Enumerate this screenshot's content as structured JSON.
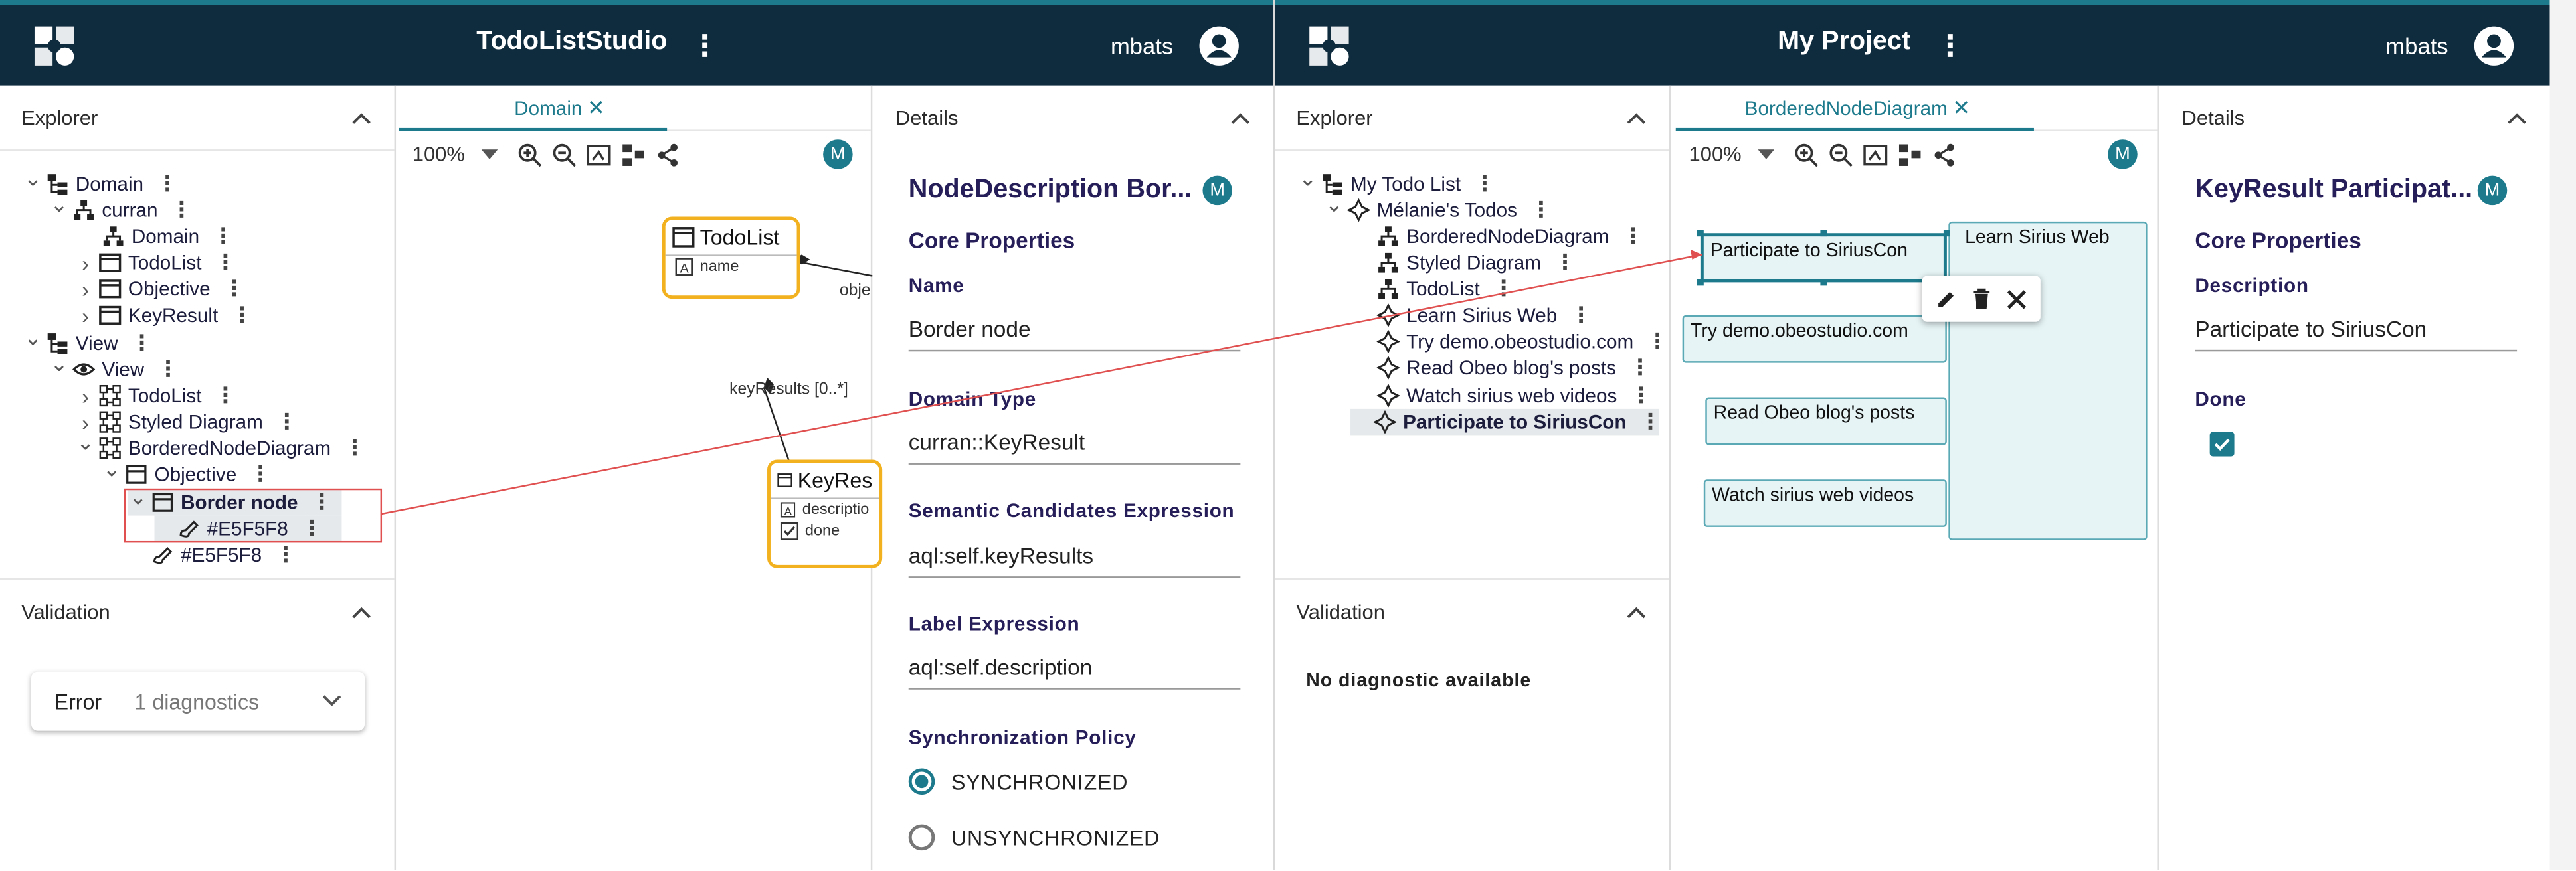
{
  "left_app": {
    "title": "TodoListStudio",
    "user": "mbats",
    "explorer": {
      "header": "Explorer",
      "items": [
        {
          "label": "Domain",
          "icon": "domain-tree-icon",
          "toggle": "v"
        },
        {
          "label": "curran",
          "icon": "hierarchy-icon",
          "toggle": "v"
        },
        {
          "label": "Domain",
          "icon": "hierarchy-icon",
          "toggle": ""
        },
        {
          "label": "TodoList",
          "icon": "entity-icon",
          "toggle": ">"
        },
        {
          "label": "Objective",
          "icon": "entity-icon",
          "toggle": ">"
        },
        {
          "label": "KeyResult",
          "icon": "entity-icon",
          "toggle": ">"
        },
        {
          "label": "View",
          "icon": "domain-tree-icon",
          "toggle": "v"
        },
        {
          "label": "View",
          "icon": "eye-icon",
          "toggle": "v"
        },
        {
          "label": "TodoList",
          "icon": "diagram-icon",
          "toggle": ">"
        },
        {
          "label": "Styled Diagram",
          "icon": "diagram-icon",
          "toggle": ">"
        },
        {
          "label": "BorderedNodeDiagram",
          "icon": "diagram-icon",
          "toggle": "v"
        },
        {
          "label": "Objective",
          "icon": "node-icon",
          "toggle": "v"
        },
        {
          "label": "Border node",
          "icon": "node-icon",
          "toggle": "v"
        },
        {
          "label": "#E5F5F8",
          "icon": "style-icon",
          "toggle": ""
        },
        {
          "label": "#E5F5F8",
          "icon": "style-icon",
          "toggle": ""
        }
      ]
    },
    "validation": {
      "header": "Validation",
      "severity": "Error",
      "count": "1 diagnostics"
    },
    "canvas": {
      "tab": "Domain",
      "zoom": "100%",
      "badge": "M",
      "nodes": {
        "todolist": {
          "title": "TodoList",
          "attr": "name"
        },
        "keyresult": {
          "title": "KeyRes",
          "attrs": [
            "descriptio",
            "done"
          ]
        }
      },
      "edge_labels": {
        "keyresults": "keyResults [0..*]",
        "obj": "obje"
      }
    },
    "details": {
      "header": "Details",
      "title": "NodeDescription Bor...",
      "badge": "M",
      "section": "Core Properties",
      "fields": [
        {
          "label": "Name",
          "value": "Border node"
        },
        {
          "label": "Domain Type",
          "value": "curran::KeyResult"
        },
        {
          "label": "Semantic Candidates Expression",
          "value": "aql:self.keyResults"
        },
        {
          "label": "Label Expression",
          "value": "aql:self.description"
        }
      ],
      "sync_label": "Synchronization Policy",
      "sync_options": [
        "SYNCHRONIZED",
        "UNSYNCHRONIZED"
      ],
      "sync_selected": "SYNCHRONIZED"
    }
  },
  "right_app": {
    "title": "My Project",
    "user": "mbats",
    "explorer": {
      "header": "Explorer",
      "items": [
        {
          "label": "My Todo List",
          "icon": "domain-tree-icon",
          "toggle": "v"
        },
        {
          "label": "Mélanie's Todos",
          "icon": "object-icon",
          "toggle": "v"
        },
        {
          "label": "BorderedNodeDiagram",
          "icon": "hierarchy-icon",
          "toggle": ""
        },
        {
          "label": "Styled Diagram",
          "icon": "hierarchy-icon",
          "toggle": ""
        },
        {
          "label": "TodoList",
          "icon": "hierarchy-icon",
          "toggle": ""
        },
        {
          "label": "Learn Sirius Web",
          "icon": "object-icon",
          "toggle": ""
        },
        {
          "label": "Try demo.obeostudio.com",
          "icon": "object-icon",
          "toggle": ""
        },
        {
          "label": "Read Obeo blog's posts",
          "icon": "object-icon",
          "toggle": ""
        },
        {
          "label": "Watch sirius web videos",
          "icon": "object-icon",
          "toggle": ""
        },
        {
          "label": "Participate to SiriusCon",
          "icon": "object-icon",
          "toggle": ""
        }
      ]
    },
    "validation": {
      "header": "Validation",
      "message": "No diagnostic available"
    },
    "canvas": {
      "tab": "BorderedNodeDiagram",
      "zoom": "100%",
      "badge": "M",
      "nodes": [
        "Participate to SiriusCon",
        "Learn Sirius Web",
        "Try demo.obeostudio.com",
        "Read Obeo blog's posts",
        "Watch sirius web videos"
      ]
    },
    "details": {
      "header": "Details",
      "title": "KeyResult Participat...",
      "badge": "M",
      "section": "Core Properties",
      "desc_label": "Description",
      "desc_value": "Participate to SiriusCon",
      "done_label": "Done",
      "done_checked": true
    }
  },
  "colors": {
    "topbar": "#0f2c3e",
    "accent": "#1c7a8c",
    "node_border": "#f2b21f",
    "annotation": "#e05050"
  }
}
